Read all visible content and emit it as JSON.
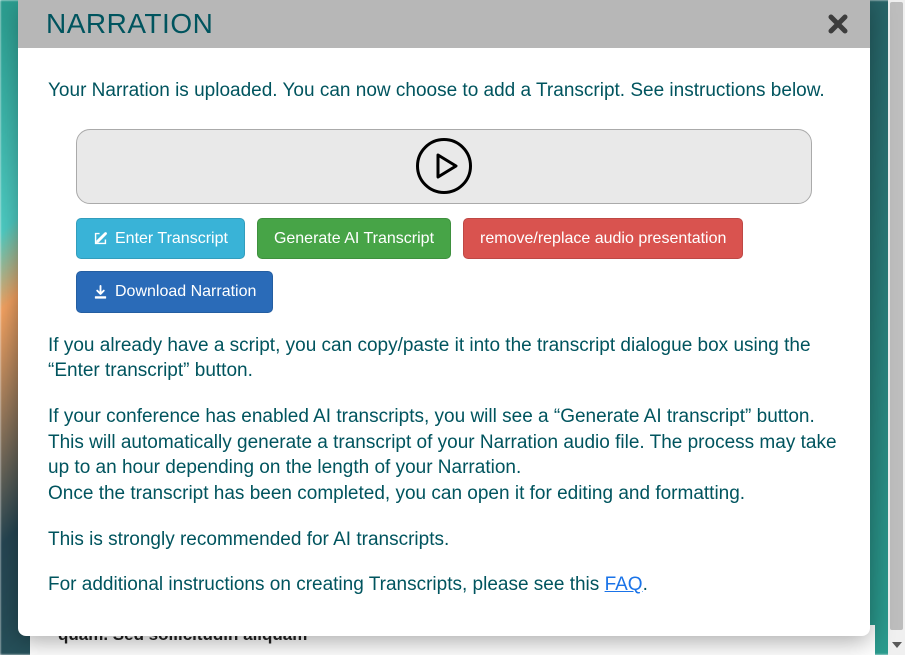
{
  "header": {
    "title": "NARRATION"
  },
  "body": {
    "intro": "Your Narration is uploaded. You can now choose to add a Transcript. See instructions below.",
    "buttons": {
      "enter_transcript": "Enter Transcript",
      "generate_ai": "Generate AI Transcript",
      "remove_replace": "remove/replace audio presentation",
      "download": "Download Narration"
    },
    "para_script": "If you already have a script, you can copy/paste it into the transcript dialogue box using the “Enter transcript” button.",
    "para_ai_1": "If your conference has enabled AI transcripts, you will see a “Generate AI transcript” button. This will automatically generate a transcript of your Narration audio file. The process may take up to an hour depending on the length of your Narration.",
    "para_ai_2": "Once the transcript has been completed, you can open it for editing and formatting.",
    "para_recommend": "This is strongly recommended for AI transcripts.",
    "para_faq_prefix": "For additional instructions on creating Transcripts, please see this ",
    "faq_label": "FAQ",
    "para_faq_suffix": "."
  },
  "background": {
    "obscured_text": "quam. Sed sollicitudin aliquam"
  }
}
